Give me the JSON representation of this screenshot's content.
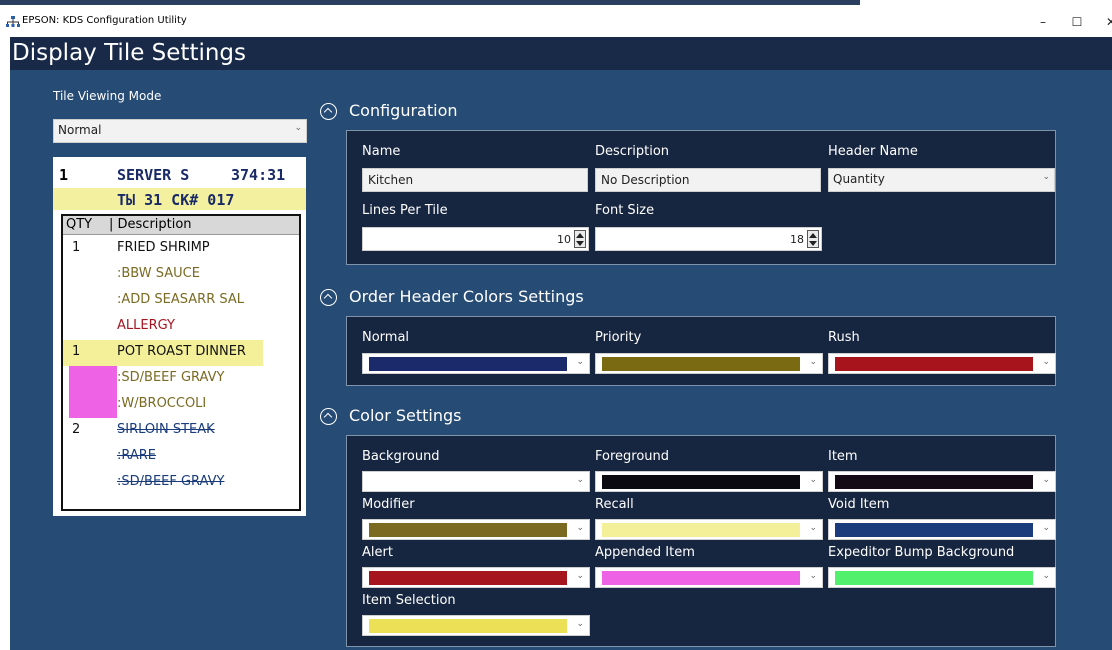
{
  "window": {
    "title": "EPSON: KDS Configuration Utility",
    "minimize": "–",
    "maximize": "☐",
    "close": "✕"
  },
  "page": {
    "title": "Display Tile Settings"
  },
  "tile_mode": {
    "label": "Tile Viewing Mode",
    "value": "Normal"
  },
  "tile_preview": {
    "header_number": "1",
    "server": "SERVER S",
    "time": "374:31",
    "subheader": "TЫ 31 CK# 017",
    "col_qty": "QTY",
    "col_desc": "| Description",
    "rows": [
      {
        "qty": "1",
        "desc": "FRIED SHRIMP"
      },
      {
        "qty": "",
        "desc": ":BBW SAUCE"
      },
      {
        "qty": "",
        "desc": ":ADD SEASARR SAL"
      },
      {
        "qty": "",
        "desc": "ALLERGY"
      },
      {
        "qty": "1",
        "desc": "POT ROAST DINNER"
      },
      {
        "qty": "",
        "desc": ":SD/BEEF GRAVY"
      },
      {
        "qty": "",
        "desc": ":W/BROCCOLI"
      },
      {
        "qty": "2",
        "desc": "SIRLOIN STEAK"
      },
      {
        "qty": "",
        "desc": ":RARE"
      },
      {
        "qty": "",
        "desc": ":SD/BEEF GRAVY"
      }
    ]
  },
  "configuration": {
    "title": "Configuration",
    "name_label": "Name",
    "name_value": "Kitchen",
    "desc_label": "Description",
    "desc_value": "No Description",
    "header_label": "Header Name",
    "header_value": "Quantity",
    "lines_label": "Lines Per Tile",
    "lines_value": "10",
    "font_label": "Font Size",
    "font_value": "18"
  },
  "order_header": {
    "title": "Order Header Colors Settings",
    "items": [
      {
        "label": "Normal",
        "color": "#1a2a6a"
      },
      {
        "label": "Priority",
        "color": "#7a6a12"
      },
      {
        "label": "Rush",
        "color": "#a8141c"
      }
    ]
  },
  "color_settings": {
    "title": "Color Settings",
    "items": [
      {
        "label": "Background",
        "color": "#ffffff"
      },
      {
        "label": "Foreground",
        "color": "#0a0a10"
      },
      {
        "label": "Item",
        "color": "#140a16"
      },
      {
        "label": "Modifier",
        "color": "#7a6a22"
      },
      {
        "label": "Recall",
        "color": "#f4f09a"
      },
      {
        "label": "Void Item",
        "color": "#1a3c7c"
      },
      {
        "label": "Alert",
        "color": "#a6141e"
      },
      {
        "label": "Appended Item",
        "color": "#ee62e6"
      },
      {
        "label": "Expeditor Bump Background",
        "color": "#52f06c"
      },
      {
        "label": "Item Selection",
        "color": "#ece056"
      }
    ]
  },
  "dropdown_chevron": "⌄"
}
